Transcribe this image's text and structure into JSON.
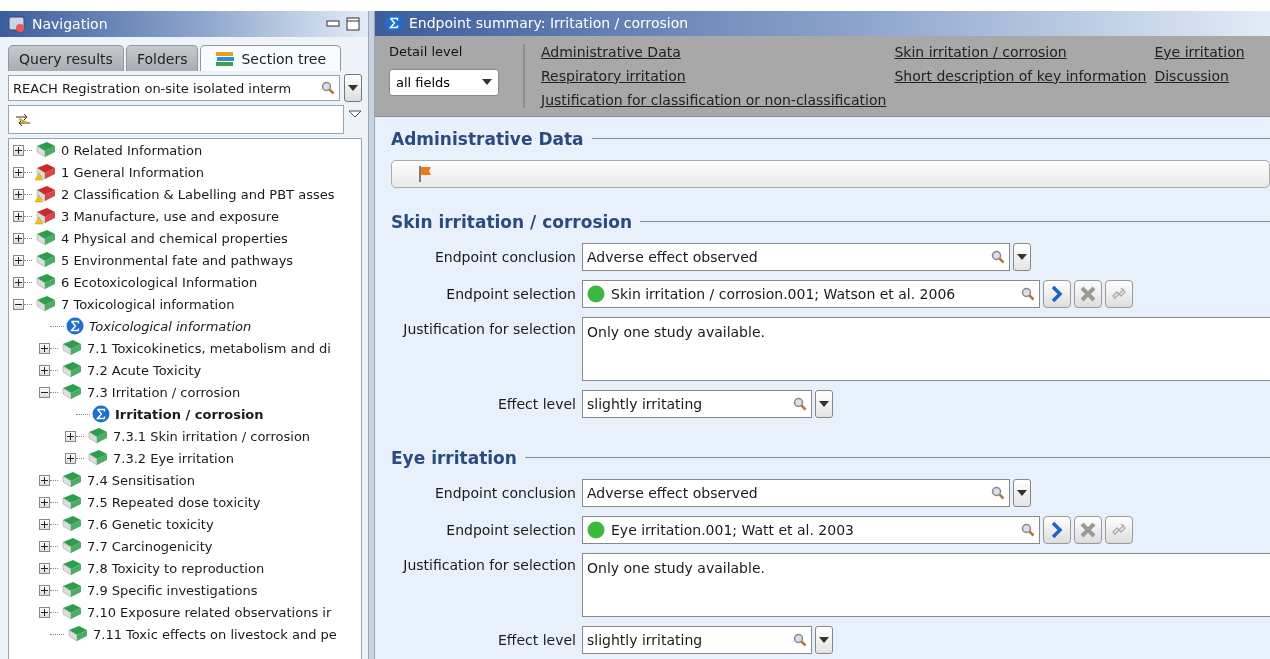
{
  "navigation": {
    "title": "Navigation",
    "tabs": [
      {
        "label": "Query results",
        "selected": false
      },
      {
        "label": "Folders",
        "selected": false
      },
      {
        "label": "Section tree",
        "selected": true
      }
    ],
    "template_field": {
      "value": "REACH Registration on-site isolated interm"
    },
    "tree": [
      {
        "label": "0 Related Information",
        "kind": "book",
        "color": "#2e9e4a",
        "warning": false,
        "expanded": false,
        "selected": false
      },
      {
        "label": "1 General Information",
        "kind": "book",
        "color": "#cc2a2a",
        "warning": true,
        "expanded": false,
        "selected": false
      },
      {
        "label": "2 Classification & Labelling and PBT asses",
        "kind": "book",
        "color": "#cc2a2a",
        "warning": true,
        "expanded": false,
        "selected": false
      },
      {
        "label": "3 Manufacture, use and exposure",
        "kind": "book",
        "color": "#cc2a2a",
        "warning": true,
        "expanded": false,
        "selected": false
      },
      {
        "label": "4 Physical and chemical properties",
        "kind": "book",
        "color": "#2e9e4a",
        "warning": false,
        "expanded": false,
        "selected": false
      },
      {
        "label": "5 Environmental fate and pathways",
        "kind": "book",
        "color": "#2e9e4a",
        "warning": false,
        "expanded": false,
        "selected": false
      },
      {
        "label": "6 Ecotoxicological Information",
        "kind": "book",
        "color": "#2e9e4a",
        "warning": false,
        "expanded": false,
        "selected": false
      },
      {
        "label": "7 Toxicological information",
        "kind": "book",
        "color": "#2e9e4a",
        "warning": false,
        "expanded": true,
        "selected": false,
        "children": [
          {
            "label": "Toxicological information",
            "kind": "summary",
            "selected": false
          },
          {
            "label": "7.1 Toxicokinetics, metabolism and di",
            "kind": "book",
            "color": "#2e9e4a",
            "warning": false,
            "expanded": false,
            "selected": false
          },
          {
            "label": "7.2 Acute Toxicity",
            "kind": "book",
            "color": "#2e9e4a",
            "warning": false,
            "expanded": false,
            "selected": false
          },
          {
            "label": "7.3 Irritation / corrosion",
            "kind": "book",
            "color": "#2e9e4a",
            "warning": false,
            "expanded": true,
            "selected": false,
            "children": [
              {
                "label": "Irritation / corrosion",
                "kind": "summary",
                "selected": true
              },
              {
                "label": "7.3.1 Skin irritation / corrosion",
                "kind": "book",
                "color": "#2e9e4a",
                "warning": false,
                "expanded": false,
                "selected": false
              },
              {
                "label": "7.3.2 Eye irritation",
                "kind": "book",
                "color": "#2e9e4a",
                "warning": false,
                "expanded": false,
                "selected": false
              }
            ]
          },
          {
            "label": "7.4 Sensitisation",
            "kind": "book",
            "color": "#2e9e4a",
            "warning": false,
            "expanded": false,
            "selected": false
          },
          {
            "label": "7.5 Repeated dose toxicity",
            "kind": "book",
            "color": "#2e9e4a",
            "warning": false,
            "expanded": false,
            "selected": false
          },
          {
            "label": "7.6 Genetic toxicity",
            "kind": "book",
            "color": "#2e9e4a",
            "warning": false,
            "expanded": false,
            "selected": false
          },
          {
            "label": "7.7 Carcinogenicity",
            "kind": "book",
            "color": "#2e9e4a",
            "warning": false,
            "expanded": false,
            "selected": false
          },
          {
            "label": "7.8 Toxicity to reproduction",
            "kind": "book",
            "color": "#2e9e4a",
            "warning": false,
            "expanded": false,
            "selected": false
          },
          {
            "label": "7.9 Specific investigations",
            "kind": "book",
            "color": "#2e9e4a",
            "warning": false,
            "expanded": false,
            "selected": false
          },
          {
            "label": "7.10 Exposure related observations ir",
            "kind": "book",
            "color": "#2e9e4a",
            "warning": false,
            "expanded": false,
            "selected": false
          },
          {
            "label": "7.11 Toxic effects on livestock and pe",
            "kind": "book",
            "color": "#2e9e4a",
            "warning": false,
            "selected": false
          }
        ]
      }
    ]
  },
  "summary": {
    "title": "Endpoint summary: Irritation / corrosion",
    "detail_level": {
      "label": "Detail level",
      "value": "all fields"
    },
    "links": [
      "Administrative Data",
      "Skin irritation / corrosion",
      "Eye irritation",
      "Respiratory irritation",
      "Short description of key information",
      "Discussion",
      "Justification for classification or non-classification"
    ],
    "sections": [
      {
        "title": "Administrative Data",
        "kind": "flagbar"
      },
      {
        "title": "Skin irritation / corrosion",
        "kind": "form",
        "fields": [
          {
            "label": "Endpoint conclusion",
            "kind": "combo",
            "value": "Adverse effect observed"
          },
          {
            "label": "Endpoint selection",
            "kind": "selection",
            "value": "Skin irritation / corrosion.001; Watson et al. 2006"
          },
          {
            "label": "Justification for selection",
            "kind": "text",
            "value": "Only one study available."
          },
          {
            "label": "Effect level",
            "kind": "picklist",
            "value": "slightly irritating"
          }
        ]
      },
      {
        "title": "Eye irritation",
        "kind": "form",
        "fields": [
          {
            "label": "Endpoint conclusion",
            "kind": "combo",
            "value": "Adverse effect observed"
          },
          {
            "label": "Endpoint selection",
            "kind": "selection",
            "value": "Eye irritation.001; Watt et al. 2003"
          },
          {
            "label": "Justification for selection",
            "kind": "text",
            "value": "Only one study available."
          },
          {
            "label": "Effect level",
            "kind": "picklist",
            "value": "slightly irritating"
          }
        ]
      }
    ]
  }
}
